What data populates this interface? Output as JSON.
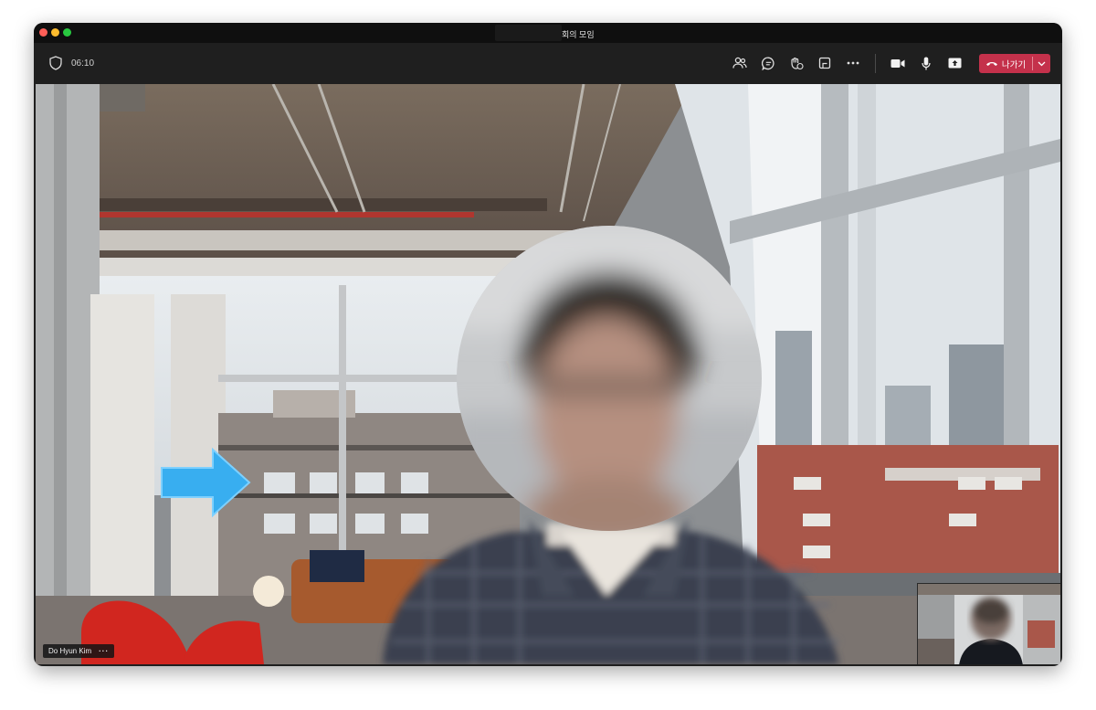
{
  "window": {
    "title": "회의 모임"
  },
  "toolbar": {
    "timer": "06:10",
    "buttons": [
      {
        "name": "participants-icon"
      },
      {
        "name": "chat-icon"
      },
      {
        "name": "reactions-icon"
      },
      {
        "name": "rooms-icon"
      },
      {
        "name": "more-icon"
      },
      {
        "name": "camera-icon"
      },
      {
        "name": "mic-icon"
      },
      {
        "name": "share-icon"
      }
    ],
    "leave_label": "나가기",
    "colors": {
      "leave": "#c4314b",
      "bar": "#1f1f1f"
    }
  },
  "stage": {
    "participant_name": "Do Hyun Kim",
    "participant_more": "···",
    "annotation_arrow_color": "#38aef0"
  }
}
